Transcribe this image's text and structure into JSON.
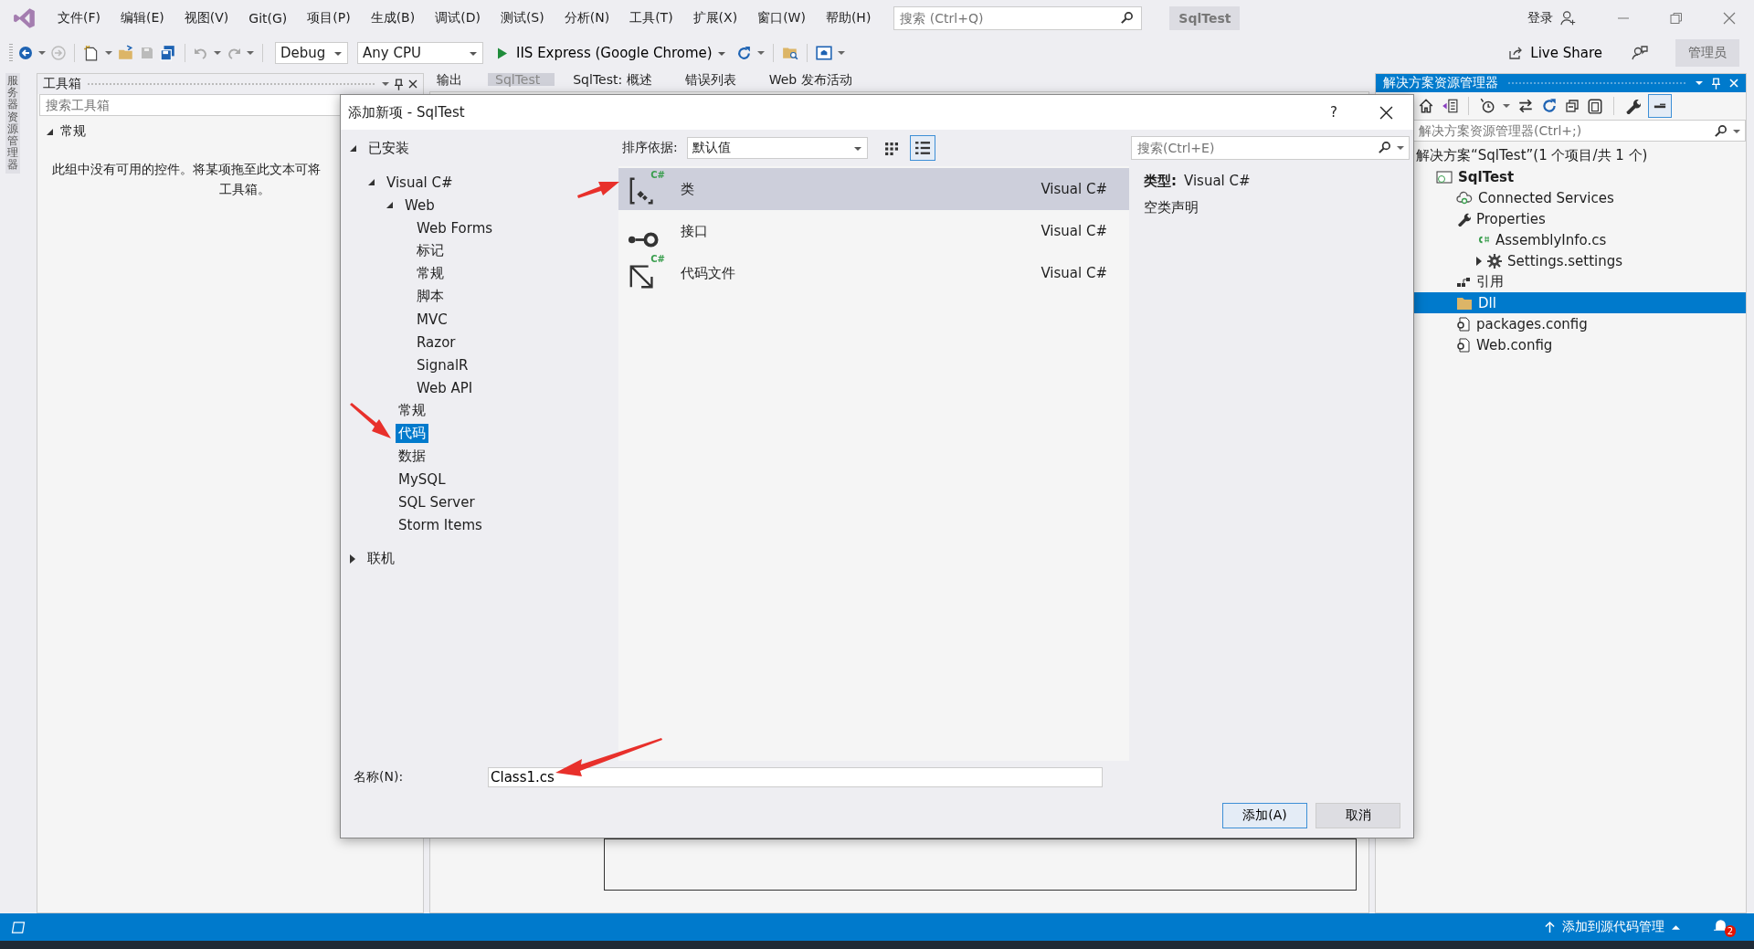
{
  "menu": [
    "文件(F)",
    "编辑(E)",
    "视图(V)",
    "Git(G)",
    "项目(P)",
    "生成(B)",
    "调试(D)",
    "测试(S)",
    "分析(N)",
    "工具(T)",
    "扩展(X)",
    "窗口(W)",
    "帮助(H)"
  ],
  "search": {
    "placeholder": "搜索 (Ctrl+Q)"
  },
  "solution_badge": "SqlTest",
  "login": "登录",
  "toolbar": {
    "config": "Debug",
    "platform": "Any CPU",
    "run": "IIS Express (Google Chrome)",
    "live_share": "Live Share",
    "admin": "管理员"
  },
  "side_strip": "服务器资源管理器",
  "toolbox": {
    "title": "工具箱",
    "search_placeholder": "搜索工具箱",
    "group": "常规",
    "group_expanded": true,
    "empty_lines": [
      "此组中没有可用的控件。将某项拖至此文本可将",
      "工具箱。"
    ]
  },
  "doc_tabs": [
    {
      "label": "输出",
      "selected": false
    },
    {
      "label": "SqlTest",
      "selected": true
    },
    {
      "label": "SqlTest: 概述",
      "selected": false
    },
    {
      "label": "错误列表",
      "selected": false
    },
    {
      "label": "Web 发布活动",
      "selected": false
    }
  ],
  "dialog": {
    "title": "添加新项 - SqlTest",
    "help": "?",
    "tree": [
      {
        "label": "已安装",
        "expanded": true,
        "selected": false,
        "children": [
          {
            "label": "Visual C#",
            "expanded": true,
            "selected": false,
            "children": [
              {
                "label": "Web",
                "expanded": true,
                "selected": false,
                "children": [
                  {
                    "label": "Web Forms",
                    "selected": false
                  },
                  {
                    "label": "标记",
                    "selected": false
                  },
                  {
                    "label": "常规",
                    "selected": false
                  },
                  {
                    "label": "脚本",
                    "selected": false
                  },
                  {
                    "label": "MVC",
                    "selected": false
                  },
                  {
                    "label": "Razor",
                    "selected": false
                  },
                  {
                    "label": "SignalR",
                    "selected": false
                  },
                  {
                    "label": "Web API",
                    "selected": false
                  }
                ]
              },
              {
                "label": "常规",
                "selected": false
              },
              {
                "label": "代码",
                "selected": true
              },
              {
                "label": "数据",
                "selected": false
              },
              {
                "label": "MySQL",
                "selected": false
              },
              {
                "label": "SQL Server",
                "selected": false
              },
              {
                "label": "Storm Items",
                "selected": false
              }
            ]
          }
        ]
      },
      {
        "label": "联机",
        "expanded": false,
        "selected": false
      }
    ],
    "sort_label": "排序依据:",
    "sort_value": "默认值",
    "view_modes": [
      {
        "kind": "grid",
        "selected": false
      },
      {
        "kind": "list",
        "selected": true
      }
    ],
    "search_placeholder": "搜索(Ctrl+E)",
    "templates": [
      {
        "name": "类",
        "lang": "Visual C#",
        "kind": "class",
        "badge": "C#",
        "selected": true
      },
      {
        "name": "接口",
        "lang": "Visual C#",
        "kind": "interface",
        "selected": false
      },
      {
        "name": "代码文件",
        "lang": "Visual C#",
        "kind": "codefile",
        "badge": "C#",
        "selected": false
      }
    ],
    "detail": {
      "type_label": "类型:",
      "type_value": "Visual C#",
      "description": "空类声明"
    },
    "name_label": "名称(N):",
    "name_value": "Class1.cs",
    "buttons": [
      {
        "label": "添加(A)",
        "kind": "primary"
      },
      {
        "label": "取消",
        "kind": "normal"
      }
    ]
  },
  "explorer": {
    "title": "解决方案资源管理器",
    "search_placeholder": "解决方案资源管理器(Ctrl+;)",
    "tree": [
      {
        "label": "解决方案“SqlTest”(1 个项目/共 1 个)",
        "selected": false,
        "children": [
          {
            "label": "SqlTest",
            "kind": "project",
            "selected": false,
            "children": [
              {
                "label": "Connected Services",
                "kind": "cloud",
                "selected": false
              },
              {
                "label": "Properties",
                "kind": "wrench",
                "selected": false,
                "children": [
                  {
                    "label": "AssemblyInfo.cs",
                    "kind": "csharp",
                    "selected": false
                  },
                  {
                    "label": "Settings.settings",
                    "kind": "gear",
                    "expanded": false,
                    "selected": false
                  }
                ]
              },
              {
                "label": "引用",
                "kind": "references",
                "selected": false
              },
              {
                "label": "Dll",
                "kind": "folder",
                "selected": true
              },
              {
                "label": "packages.config",
                "kind": "config",
                "selected": false
              },
              {
                "label": "Web.config",
                "kind": "config",
                "selected": false
              }
            ]
          }
        ]
      }
    ]
  },
  "status": {
    "source_control": "添加到源代码管理",
    "notifications": "2"
  }
}
